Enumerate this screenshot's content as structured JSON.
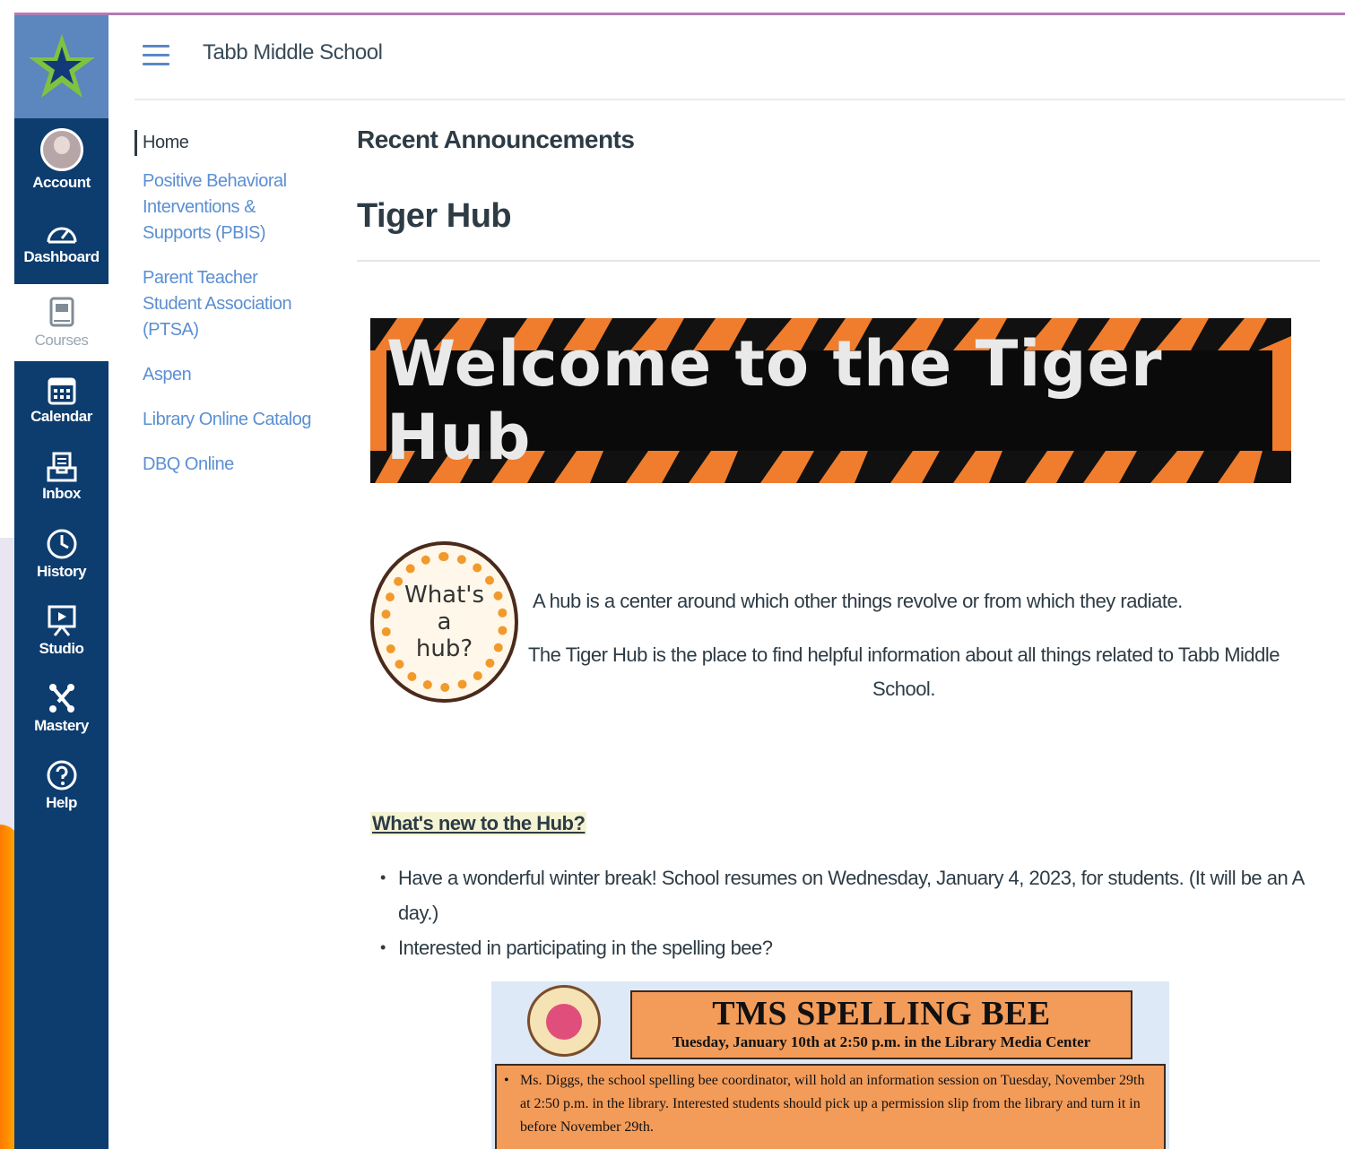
{
  "header": {
    "breadcrumb": "Tabb Middle School"
  },
  "global_nav": {
    "items": [
      {
        "label": "Account",
        "icon": "avatar"
      },
      {
        "label": "Dashboard",
        "icon": "dashboard-icon"
      },
      {
        "label": "Courses",
        "icon": "courses-icon"
      },
      {
        "label": "Calendar",
        "icon": "calendar-icon"
      },
      {
        "label": "Inbox",
        "icon": "inbox-icon"
      },
      {
        "label": "History",
        "icon": "history-icon"
      },
      {
        "label": "Studio",
        "icon": "studio-icon"
      },
      {
        "label": "Mastery",
        "icon": "mastery-icon"
      },
      {
        "label": "Help",
        "icon": "help-icon"
      }
    ],
    "active": "Courses",
    "colors": {
      "background": "#0d3c6e",
      "logo_block": "#5b86be"
    }
  },
  "course_nav": {
    "items": [
      {
        "label": "Home"
      },
      {
        "label": "Positive Behavioral Interventions & Supports (PBIS)"
      },
      {
        "label": "Parent Teacher Student Association (PTSA)"
      },
      {
        "label": "Aspen"
      },
      {
        "label": "Library Online Catalog"
      },
      {
        "label": "DBQ Online"
      }
    ],
    "active": "Home",
    "link_color": "#5b8fd3"
  },
  "main": {
    "recent_heading": "Recent Announcements",
    "page_title": "Tiger Hub",
    "banner_text": "Welcome to the Tiger Hub",
    "badge_lines": [
      "What's",
      "a",
      "hub?"
    ],
    "hub_definition": "A hub is a center around which other things revolve or from which they radiate.",
    "hub_description": "The Tiger Hub is the place to find helpful information about all things related to Tabb Middle School.",
    "whats_new_heading": "What's new to the Hub?",
    "news_items": [
      "Have a wonderful winter break! School resumes on Wednesday, January 4, 2023, for students. (It will be an A day.)",
      "Interested in participating in the spelling bee?"
    ],
    "spelling_bee": {
      "title": "TMS SPELLING BEE",
      "subtitle": "Tuesday, January 10th at 2:50 p.m. in the Library Media Center",
      "body": "Ms. Diggs, the school spelling bee coordinator, will hold an information session on Tuesday, November 29th at 2:50 p.m. in the library. Interested students should pick up a permission slip from the library and turn it in before November 29th."
    }
  }
}
